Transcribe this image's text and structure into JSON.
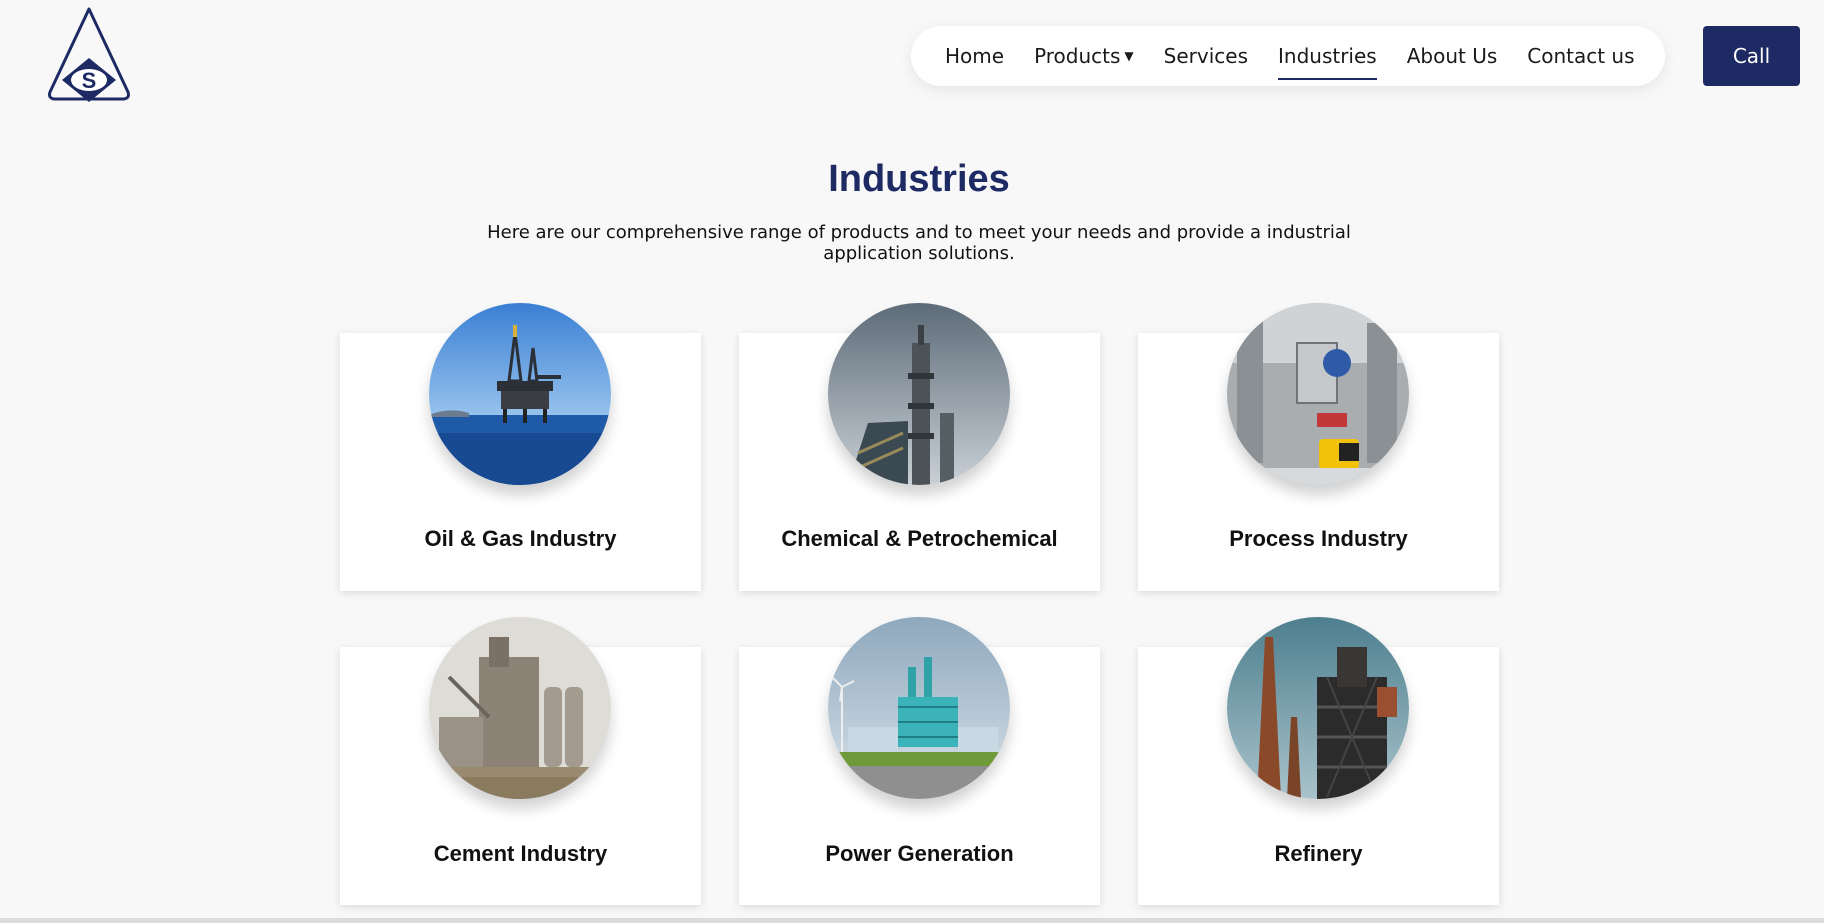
{
  "header": {
    "logo_icon": "company-logo",
    "nav": [
      {
        "label": "Home",
        "active": false
      },
      {
        "label": "Products",
        "active": false,
        "has_dropdown": true
      },
      {
        "label": "Services",
        "active": false
      },
      {
        "label": "Industries",
        "active": true
      },
      {
        "label": "About Us",
        "active": false
      },
      {
        "label": "Contact us",
        "active": false
      }
    ],
    "call_label": "Call"
  },
  "hero": {
    "title": "Industries",
    "subtitle": "Here are our comprehensive range of products and to meet your needs and provide a industrial application solutions."
  },
  "industries": [
    {
      "label": "Oil & Gas Industry",
      "image": "offshore-oil-rig-photo"
    },
    {
      "label": "Chemical & Petrochemical",
      "image": "chemical-plant-tower-photo"
    },
    {
      "label": "Process Industry",
      "image": "process-machinery-photo"
    },
    {
      "label": "Cement Industry",
      "image": "cement-plant-photo"
    },
    {
      "label": "Power Generation",
      "image": "power-plant-photo"
    },
    {
      "label": "Refinery",
      "image": "refinery-structure-photo"
    }
  ],
  "colors": {
    "brand_navy": "#1e2a63",
    "page_bg": "#f8f8f8",
    "card_bg": "#ffffff"
  }
}
